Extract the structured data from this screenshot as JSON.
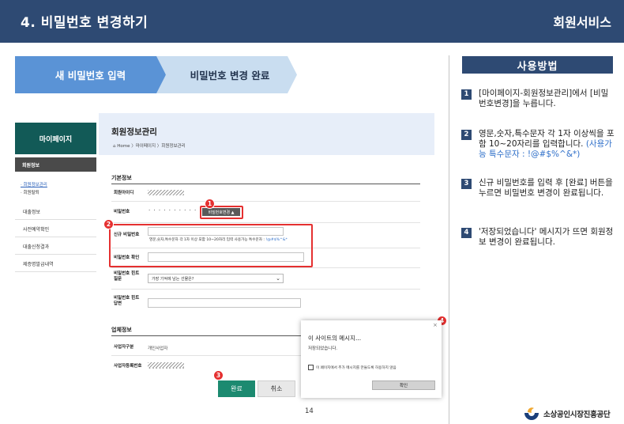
{
  "header": {
    "title": "4. 비밀번호 변경하기",
    "section": "회원서비스"
  },
  "steps": {
    "step1": "새 비밀번호 입력",
    "step2": "비밀번호 변경 완료"
  },
  "usage": {
    "title": "사용방법",
    "items": [
      {
        "num": "1",
        "text": "[마이페이지-회원정보관리]에서 [비밀번호변경]을 누릅니다."
      },
      {
        "num": "2",
        "text": "영문,숫자,특수문자 각 1자 이상씩을 포함 10~20자리를 입력합니다.",
        "note": "(사용가능 특수문자 : !@#$%^&*)"
      },
      {
        "num": "3",
        "text": "신규 비밀번호를 입력 후 [완료] 버튼을 누르면 비밀번호 변경이 완료됩니다."
      },
      {
        "num": "4",
        "text": "'저장되었습니다' 메시지가 뜨면 회원정보 변경이 완료됩니다."
      }
    ]
  },
  "sidebar": {
    "header": "마이페이지",
    "section": "회원정보",
    "subs": [
      "· 회원정보관리",
      "· 회원탈퇴"
    ],
    "items": [
      "대출정보",
      "사전예약확인",
      "대출신청결과",
      "제증명발급내역"
    ]
  },
  "panel": {
    "title": "회원정보관리",
    "breadcrumb": "⌂  Home 〉마이페이지 〉회원정보관리",
    "basic_title": "기본정보",
    "id_label": "회원아이디",
    "pw_label": "비밀번호",
    "pw_value": "· · · · · · · · · · ·",
    "pw_change_button": "비밀번호변경 ▲",
    "new_pw_label": "신규 비밀번호",
    "pw_hint": "영문,숫자,특수문자 각 1자 이상 포함 10~20자리 입력  사용가능 특수문자 :",
    "pw_hint_chars": "!@#$%^&*",
    "confirm_label": "비밀번호 확인",
    "hint_q_label_1": "비밀번호 힌트",
    "hint_q_label_2": "질문",
    "hint_q_value": "가장 기억에 남는 선물은?",
    "hint_a_label_1": "비밀번호 힌트",
    "hint_a_label_2": "답변",
    "biz_title": "업체정보",
    "biz_type_label": "사업자구분",
    "biz_type_value": "개인사업자",
    "biz_num_label": "사업자등록번호",
    "done_button": "완료",
    "cancel_button": "취소"
  },
  "markers": [
    "1",
    "2",
    "3",
    "4"
  ],
  "dialog": {
    "title": "이 사이트의 메시지...",
    "message": "저장되었습니다.",
    "checkbox_label": "이 페이지에서 추가 메시지를 만들도록 허용하지 않음",
    "ok_button": "확인",
    "close": "×"
  },
  "footer": {
    "page": "14",
    "org": "소상공인시장진흥공단"
  },
  "colors": {
    "header": "#2e4a73",
    "step_active": "#5a93d6",
    "step_next": "#c9ddf0",
    "sidebar": "#125a57",
    "marker": "#e53030",
    "done_button": "#1c8a70"
  }
}
